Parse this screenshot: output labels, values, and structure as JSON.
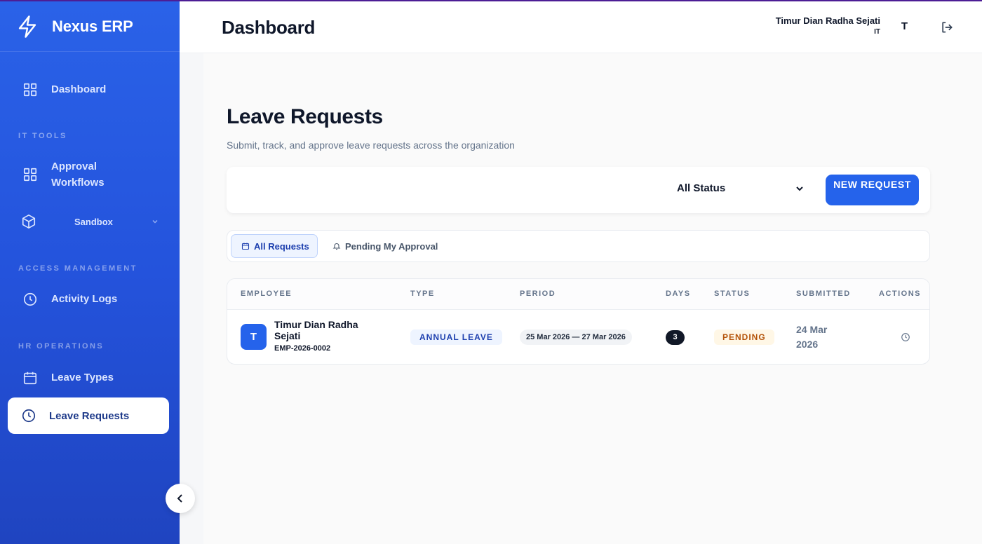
{
  "app": {
    "name": "Nexus ERP"
  },
  "sidebar": {
    "items": [
      {
        "label": "Dashboard",
        "icon": "grid-icon"
      },
      {
        "section": "IT TOOLS"
      },
      {
        "label": "Approval Workflows",
        "icon": "grid-icon"
      },
      {
        "label": "Sandbox",
        "icon": "box-icon"
      },
      {
        "section": "ACCESS MANAGEMENT"
      },
      {
        "label": "Activity Logs",
        "icon": "clock-icon"
      },
      {
        "section": "HR OPERATIONS"
      },
      {
        "label": "Leave Types",
        "icon": "calendar-icon"
      },
      {
        "label": "Leave Requests",
        "icon": "clock-icon",
        "active": true
      }
    ]
  },
  "header": {
    "title": "Dashboard",
    "user_name": "Timur Dian Radha Sejati",
    "user_dept": "IT",
    "avatar_initial": "T"
  },
  "page": {
    "title": "Leave Requests",
    "subtitle": "Submit, track, and approve leave requests across the organization"
  },
  "filter": {
    "status_value": "All Status",
    "new_request_label": "NEW REQUEST"
  },
  "tabs": [
    {
      "label": "All Requests",
      "active": true
    },
    {
      "label": "Pending My Approval",
      "active": false
    }
  ],
  "table": {
    "columns": [
      "EMPLOYEE",
      "TYPE",
      "PERIOD",
      "DAYS",
      "STATUS",
      "SUBMITTED",
      "ACTIONS"
    ],
    "rows": [
      {
        "initial": "T",
        "name": "Timur Dian Radha Sejati",
        "employee_id": "EMP-2026-0002",
        "type": "ANNUAL LEAVE",
        "period": "25 Mar 2026 — 27 Mar 2026",
        "days": "3",
        "status": "PENDING",
        "submitted": "24 Mar 2026"
      }
    ]
  },
  "colors": {
    "sidebar": "#2a62e8",
    "accent": "#2563eb",
    "pending_bg": "#fff7e6",
    "pending_text": "#b45309"
  }
}
